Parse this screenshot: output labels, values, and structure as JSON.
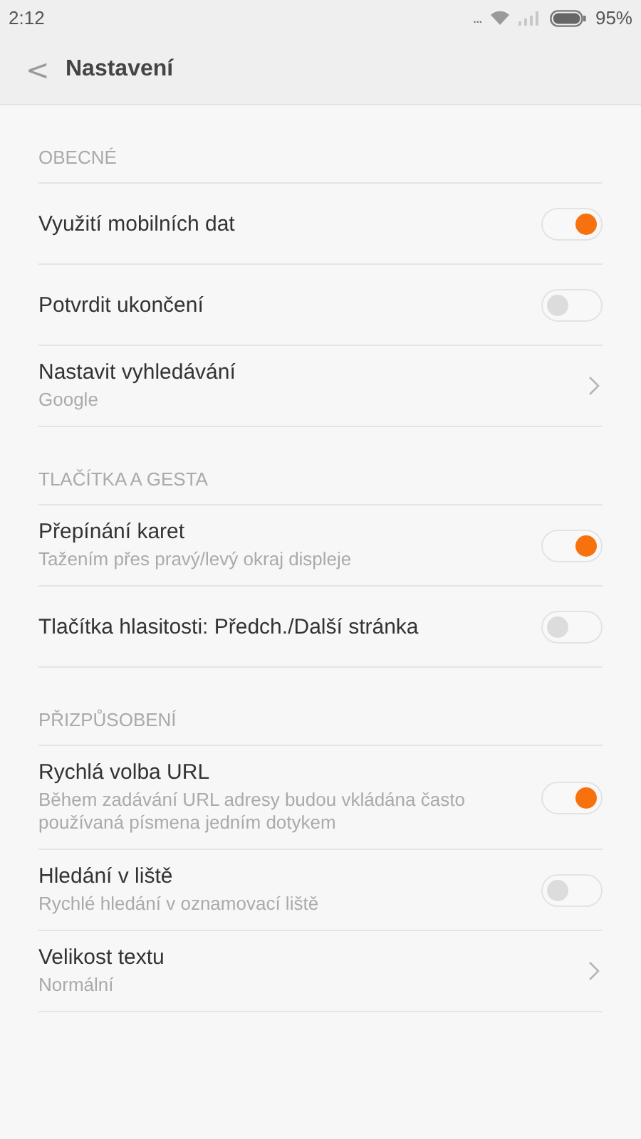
{
  "status_bar": {
    "time": "2:12",
    "more": "...",
    "battery": "95%"
  },
  "header": {
    "back": "<",
    "title": "Nastavení"
  },
  "sections": [
    {
      "title": "OBECNÉ",
      "items": [
        {
          "kind": "toggle",
          "label": "Využití mobilních dat",
          "on": true
        },
        {
          "kind": "toggle",
          "label": "Potvrdit ukončení",
          "on": false
        },
        {
          "kind": "link",
          "label": "Nastavit vyhledávání",
          "subtitle": "Google"
        }
      ]
    },
    {
      "title": "TLAČÍTKA A GESTA",
      "items": [
        {
          "kind": "toggle",
          "label": "Přepínání karet",
          "subtitle": "Tažením přes pravý/levý okraj displeje",
          "on": true
        },
        {
          "kind": "toggle",
          "label": "Tlačítka hlasitosti: Předch./Další stránka",
          "on": false
        }
      ]
    },
    {
      "title": "PŘIZPŮSOBENÍ",
      "items": [
        {
          "kind": "toggle",
          "label": "Rychlá volba URL",
          "subtitle": "Během zadávání URL adresy budou vkládána často používaná písmena jedním dotykem",
          "on": true
        },
        {
          "kind": "toggle",
          "label": "Hledání v liště",
          "subtitle": "Rychlé hledání v oznamovací liště",
          "on": false
        },
        {
          "kind": "link",
          "label": "Velikost textu",
          "subtitle": "Normální"
        }
      ]
    }
  ]
}
